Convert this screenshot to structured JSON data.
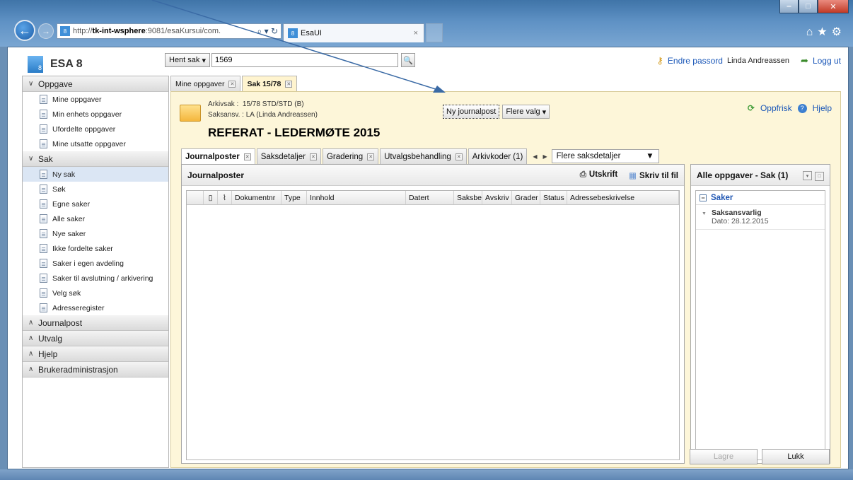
{
  "browser": {
    "address_prefix": "http://",
    "address_host": "tk-int-wsphere",
    "address_rest": ":9081/esaKursui/com.",
    "tab_title": "EsaUI",
    "tab_close": "×",
    "favicon_text": "8"
  },
  "app": {
    "logo_text": "ESA 8",
    "logo_badge": "8",
    "hent_label": "Hent sak",
    "hent_value": "1569",
    "change_password": "Endre passord",
    "user_name": "Linda Andreassen",
    "logout": "Logg ut"
  },
  "sidebar": {
    "oppgave": {
      "header": "Oppgave",
      "items": [
        "Mine oppgaver",
        "Min enhets oppgaver",
        "Ufordelte oppgaver",
        "Mine utsatte oppgaver"
      ]
    },
    "sak": {
      "header": "Sak",
      "items": [
        "Ny sak",
        "Søk",
        "Egne saker",
        "Alle saker",
        "Nye saker",
        "Ikke fordelte saker",
        "Saker i egen avdeling",
        "Saker til avslutning / arkivering",
        "Velg søk",
        "Adresseregister"
      ]
    },
    "collapsed": [
      "Journalpost",
      "Utvalg",
      "Hjelp",
      "Brukeradministrasjon"
    ]
  },
  "main": {
    "tabs": [
      "Mine oppgaver",
      "Sak 15/78"
    ],
    "arkivsak_label": "Arkivsak :",
    "arkivsak_value": "15/78 STD/STD (B)",
    "saksansv_label": "Saksansv. :",
    "saksansv_value": "LA (Linda Andreassen)",
    "case_title": "REFERAT - LEDERMØTE 2015",
    "btn_ny_journalpost": "Ny journalpost",
    "btn_flere_valg": "Flere valg",
    "refresh": "Oppfrisk",
    "help": "Hjelp",
    "subtabs": [
      "Journalposter",
      "Saksdetaljer",
      "Gradering",
      "Utvalgsbehandling",
      "Arkivkoder (1)"
    ],
    "more_details": "Flere saksdetaljer"
  },
  "journalposter": {
    "title": "Journalposter",
    "print": "Utskrift",
    "write_file": "Skriv til fil",
    "columns": [
      "Dokumentnr",
      "Type",
      "Innhold",
      "Datert",
      "Saksbe",
      "Avskriv",
      "Grader",
      "Status",
      "Adressebeskrivelse"
    ]
  },
  "tasks": {
    "title": "Alle oppgaver - Sak (1)",
    "group": "Saker",
    "item_title": "Saksansvarlig",
    "item_date": "Dato: 28.12.2015"
  },
  "buttons": {
    "save": "Lagre",
    "close": "Lukk"
  },
  "colors": {
    "accent": "#1a57b8",
    "panel_bg": "#fdf6d9",
    "selected": "#dbe6f4"
  }
}
